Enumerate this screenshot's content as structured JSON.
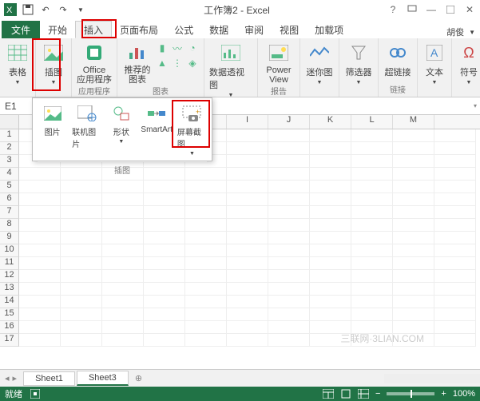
{
  "title": "工作簿2 - Excel",
  "user": "胡俊",
  "file_tab": "文件",
  "tabs": [
    "开始",
    "插入",
    "页面布局",
    "公式",
    "数据",
    "审阅",
    "视图",
    "加载项"
  ],
  "active_tab_index": 1,
  "ribbon": {
    "groups": [
      "表格",
      "插图",
      "应用程序",
      "推荐的图表",
      "图表",
      "数据透视图",
      "报告",
      "迷你图",
      "筛选器",
      "链接",
      "文本",
      "符号"
    ],
    "btn_tables": "表格",
    "btn_illus": "插图",
    "btn_office": "Office\n应用程序",
    "btn_reco": "推荐的\n图表",
    "btn_pivot": "数据透视图",
    "btn_power": "Power\nView",
    "btn_spark": "迷你图",
    "btn_filter": "筛选器",
    "btn_link": "超链接",
    "btn_text": "文本",
    "btn_symbol": "符号"
  },
  "namebox": "E1",
  "panel": {
    "pic": "图片",
    "onlinepic": "联机图片",
    "shapes": "形状",
    "smartart": "SmartArt",
    "screenshot": "屏幕截图",
    "group_label": "插图"
  },
  "columns": [
    "I",
    "J",
    "K",
    "L",
    "M"
  ],
  "rows": [
    1,
    2,
    3,
    4,
    5,
    6,
    7,
    8,
    9,
    10,
    11,
    12,
    13,
    14,
    15,
    16,
    17
  ],
  "row_pad": 5,
  "sheets": [
    "Sheet1",
    "Sheet3"
  ],
  "active_sheet_index": 1,
  "status": {
    "ready": "就绪",
    "zoom": "100%"
  },
  "watermark": "三联网·3LIAN.COM"
}
